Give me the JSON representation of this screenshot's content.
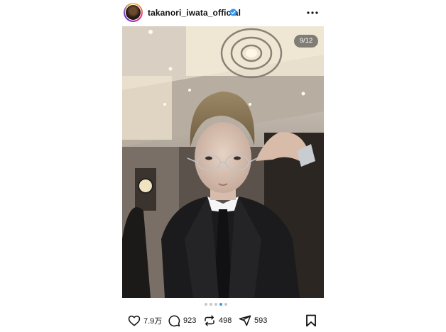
{
  "post": {
    "username": "takanori_iwata_official",
    "image_counter": "9/12",
    "carousel": {
      "total_dots": 5,
      "active_dot": 3
    }
  },
  "actions": {
    "likes": "7.9万",
    "comments": "923",
    "reposts": "498",
    "shares": "593"
  },
  "colors": {
    "verified": "#3897f0",
    "active_dot": "#3897f0"
  }
}
